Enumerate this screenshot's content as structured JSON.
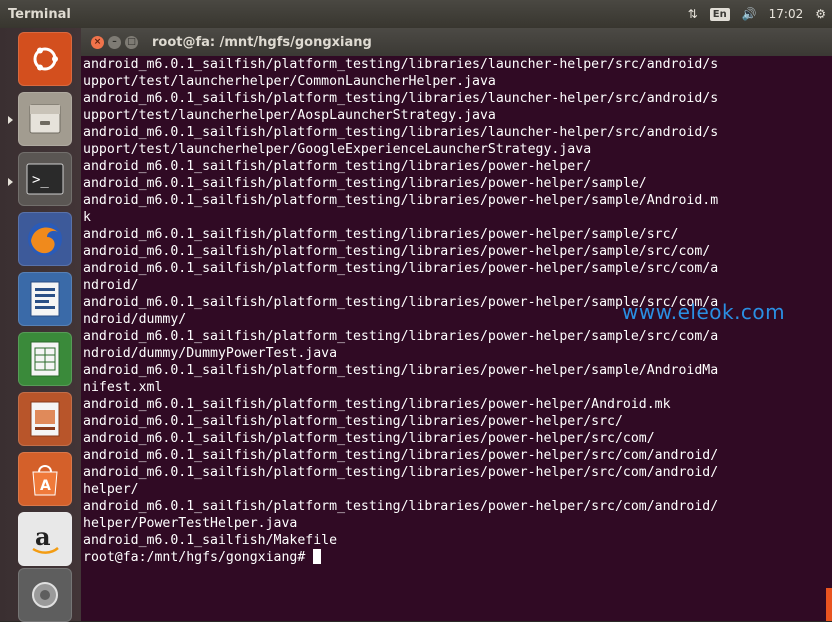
{
  "top_panel": {
    "title": "Terminal",
    "keyboard_layout": "En",
    "time": "17:02"
  },
  "window": {
    "title": "root@fa: /mnt/hgfs/gongxiang"
  },
  "terminal": {
    "lines": [
      "android_m6.0.1_sailfish/platform_testing/libraries/launcher-helper/src/android/s",
      "upport/test/launcherhelper/CommonLauncherHelper.java",
      "android_m6.0.1_sailfish/platform_testing/libraries/launcher-helper/src/android/s",
      "upport/test/launcherhelper/AospLauncherStrategy.java",
      "android_m6.0.1_sailfish/platform_testing/libraries/launcher-helper/src/android/s",
      "upport/test/launcherhelper/GoogleExperienceLauncherStrategy.java",
      "android_m6.0.1_sailfish/platform_testing/libraries/power-helper/",
      "android_m6.0.1_sailfish/platform_testing/libraries/power-helper/sample/",
      "android_m6.0.1_sailfish/platform_testing/libraries/power-helper/sample/Android.m",
      "k",
      "android_m6.0.1_sailfish/platform_testing/libraries/power-helper/sample/src/",
      "android_m6.0.1_sailfish/platform_testing/libraries/power-helper/sample/src/com/",
      "android_m6.0.1_sailfish/platform_testing/libraries/power-helper/sample/src/com/a",
      "ndroid/",
      "android_m6.0.1_sailfish/platform_testing/libraries/power-helper/sample/src/com/a",
      "ndroid/dummy/",
      "android_m6.0.1_sailfish/platform_testing/libraries/power-helper/sample/src/com/a",
      "ndroid/dummy/DummyPowerTest.java",
      "android_m6.0.1_sailfish/platform_testing/libraries/power-helper/sample/AndroidMa",
      "nifest.xml",
      "android_m6.0.1_sailfish/platform_testing/libraries/power-helper/Android.mk",
      "android_m6.0.1_sailfish/platform_testing/libraries/power-helper/src/",
      "android_m6.0.1_sailfish/platform_testing/libraries/power-helper/src/com/",
      "android_m6.0.1_sailfish/platform_testing/libraries/power-helper/src/com/android/",
      "android_m6.0.1_sailfish/platform_testing/libraries/power-helper/src/com/android/",
      "helper/",
      "android_m6.0.1_sailfish/platform_testing/libraries/power-helper/src/com/android/",
      "helper/PowerTestHelper.java",
      "android_m6.0.1_sailfish/Makefile"
    ],
    "prompt": "root@fa:/mnt/hgfs/gongxiang# "
  },
  "watermark": "www.eleok.com",
  "launcher": {
    "items": [
      {
        "icon": "dash-icon",
        "color": "#e95420"
      },
      {
        "icon": "files-icon",
        "color": "#b7b1a6"
      },
      {
        "icon": "terminal-icon",
        "color": "#2d2d2d"
      },
      {
        "icon": "firefox-icon",
        "color": "#e66000"
      },
      {
        "icon": "writer-icon",
        "color": "#3f7fc1"
      },
      {
        "icon": "calc-icon",
        "color": "#3b9a3b"
      },
      {
        "icon": "impress-icon",
        "color": "#c7552a"
      },
      {
        "icon": "software-center-icon",
        "color": "#dd6428"
      },
      {
        "icon": "amazon-icon",
        "color": "#f1f1f1"
      },
      {
        "icon": "settings-icon",
        "color": "#6a6a6a"
      }
    ]
  },
  "colors": {
    "terminal_bg": "#300a24",
    "accent": "#e95420"
  }
}
